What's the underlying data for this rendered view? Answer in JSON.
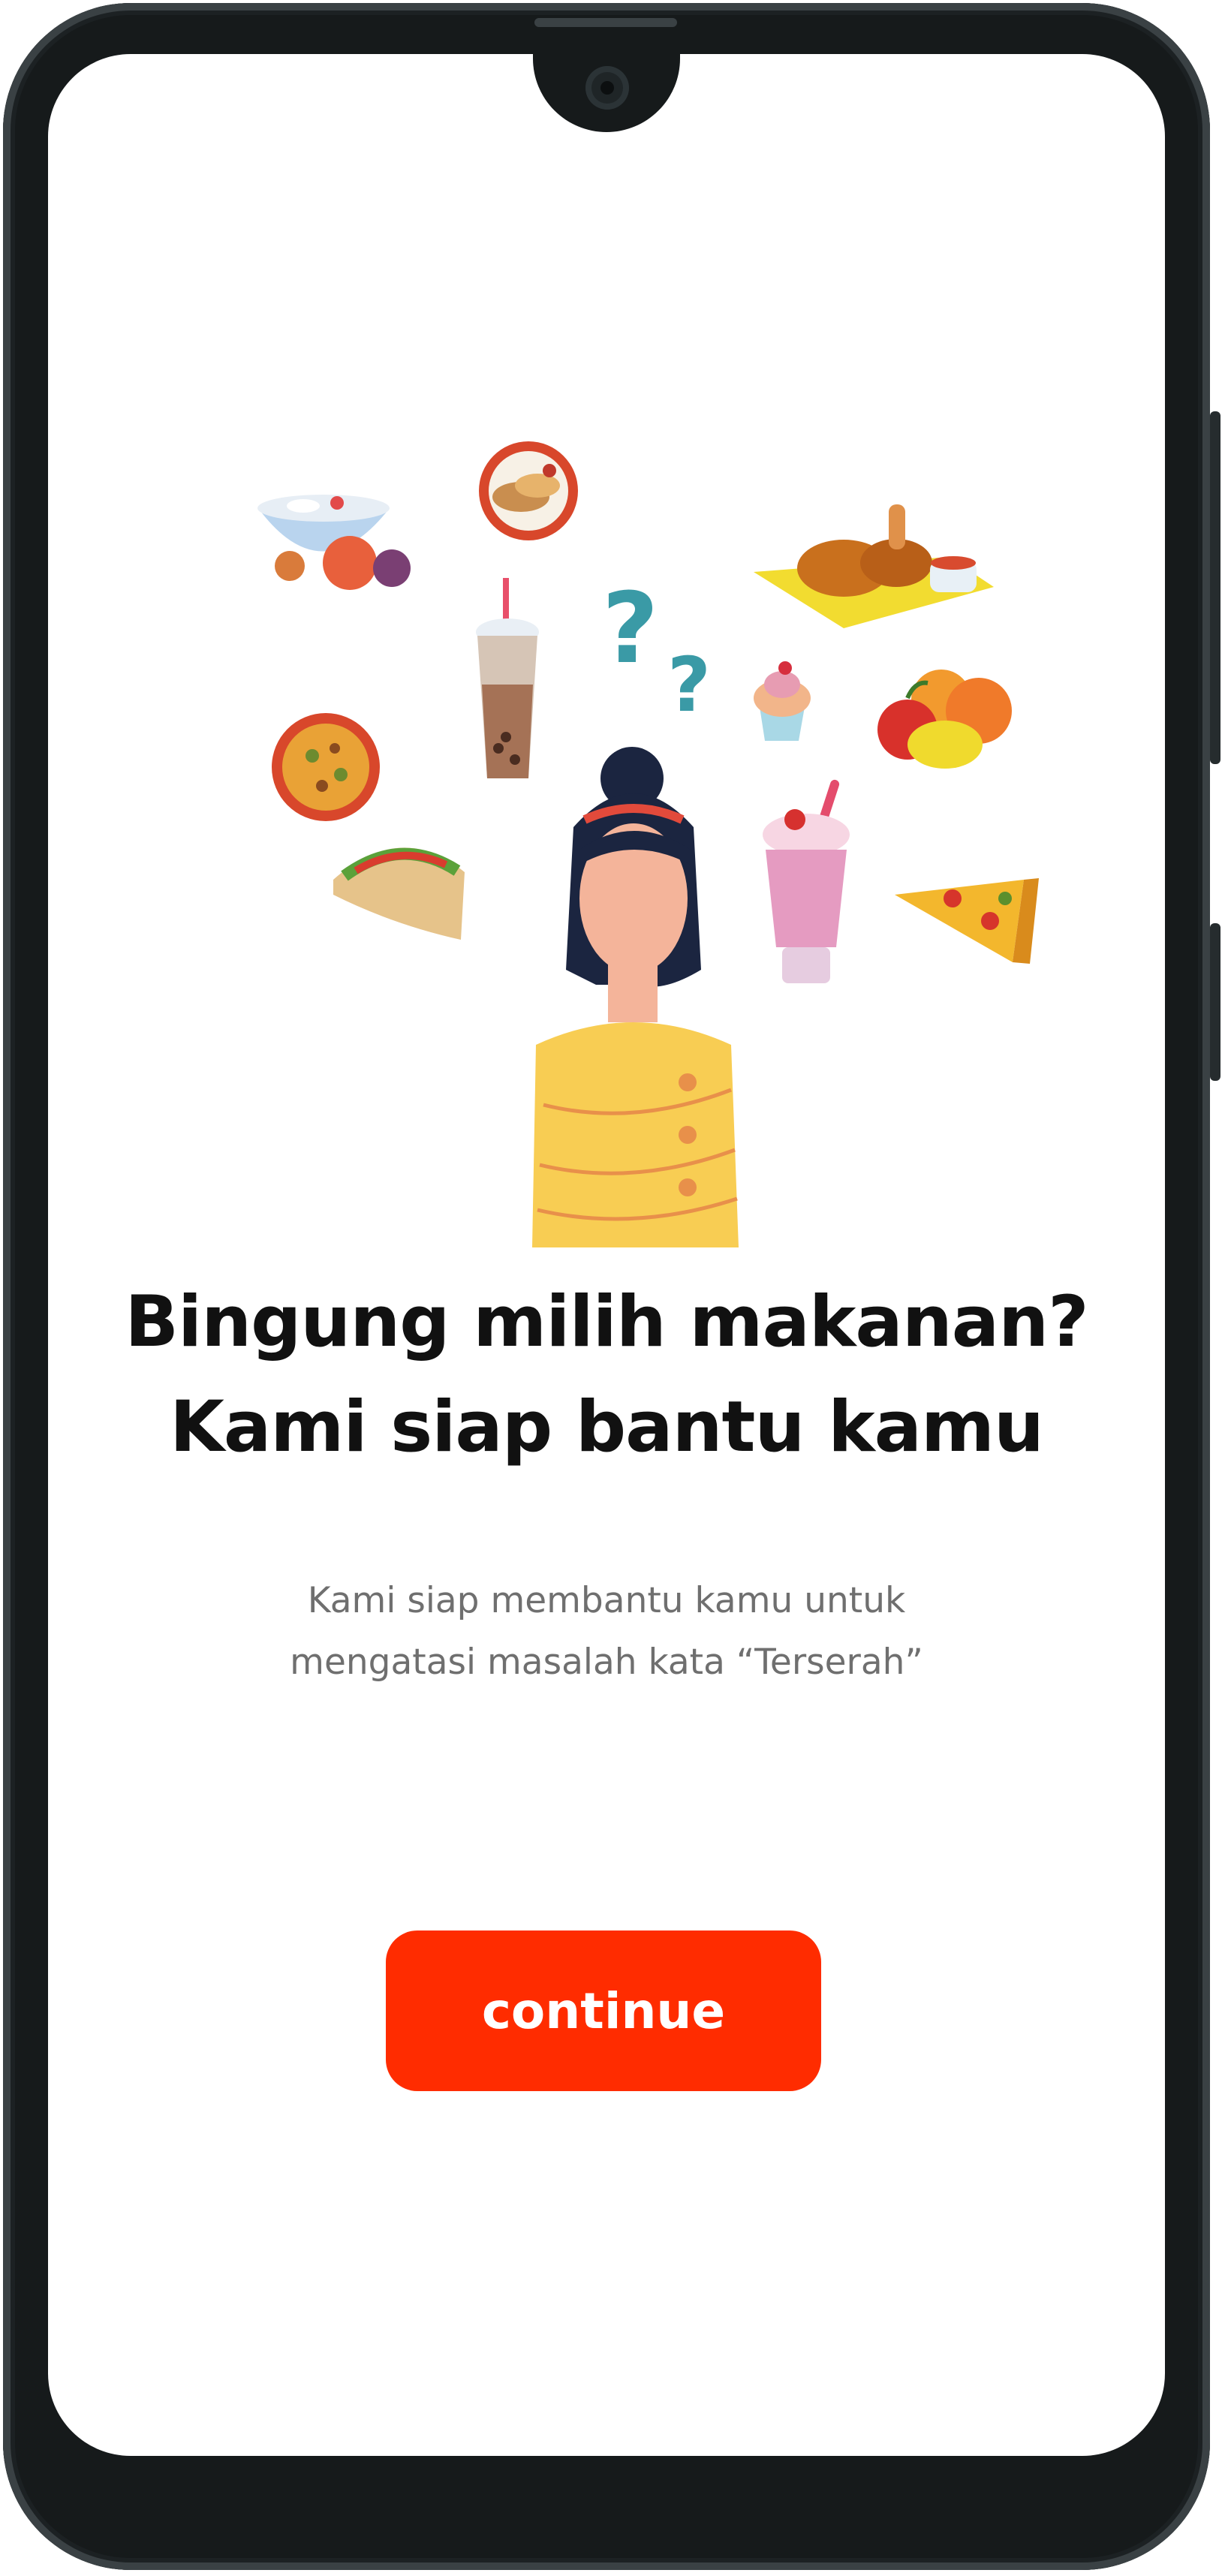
{
  "onboarding": {
    "headline_line1": "Bingung milih makanan?",
    "headline_line2": "Kami siap bantu kamu",
    "subtitle_line1": "Kami siap membantu kamu untuk",
    "subtitle_line2": "mengatasi masalah kata “Terserah”",
    "continue_label": "continue"
  },
  "colors": {
    "accent": "#ff2c00",
    "headline": "#111111",
    "subtitle": "#6f6f6f",
    "device_frame": "#161a1b"
  },
  "illustration": {
    "icons": [
      "fruit-bowl-icon",
      "pancake-plate-icon",
      "fried-chicken-icon",
      "question-marks-icon",
      "bubble-tea-icon",
      "cupcake-icon",
      "soup-bowl-icon",
      "mixed-fruit-icon",
      "taco-icon",
      "milkshake-icon",
      "pizza-slice-icon",
      "confused-woman-icon"
    ]
  }
}
